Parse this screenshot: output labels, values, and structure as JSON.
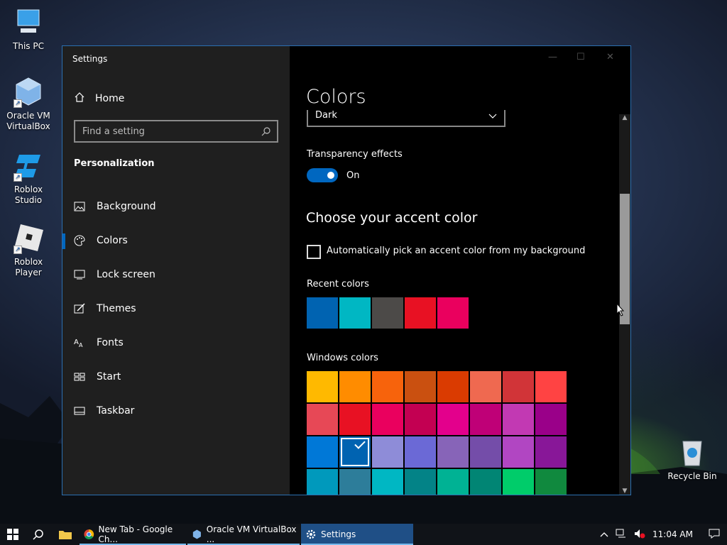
{
  "desktop": {
    "icons": [
      {
        "label": "This PC"
      },
      {
        "label": "Oracle VM VirtualBox"
      },
      {
        "label": "Roblox Studio"
      },
      {
        "label": "Roblox Player"
      },
      {
        "label": "Recycle Bin"
      }
    ]
  },
  "window": {
    "title": "Settings",
    "sidebar": {
      "home_label": "Home",
      "search_placeholder": "Find a setting",
      "section_title": "Personalization",
      "items": [
        {
          "label": "Background",
          "icon": "picture-icon"
        },
        {
          "label": "Colors",
          "icon": "palette-icon",
          "selected": true
        },
        {
          "label": "Lock screen",
          "icon": "lock-screen-icon"
        },
        {
          "label": "Themes",
          "icon": "brush-icon"
        },
        {
          "label": "Fonts",
          "icon": "fonts-icon"
        },
        {
          "label": "Start",
          "icon": "start-icon"
        },
        {
          "label": "Taskbar",
          "icon": "taskbar-icon"
        }
      ]
    },
    "content": {
      "page_title": "Colors",
      "mode_dropdown_value": "Dark",
      "transparency_label": "Transparency effects",
      "transparency_state": "On",
      "accent_heading": "Choose your accent color",
      "auto_accent_label": "Automatically pick an accent color from my background",
      "auto_accent_checked": false,
      "recent_colors_label": "Recent colors",
      "recent_colors": [
        "#0063b1",
        "#00b7c3",
        "#4c4a48",
        "#e81123",
        "#ea005e"
      ],
      "windows_colors_label": "Windows colors",
      "windows_colors": [
        [
          "#ffb900",
          "#ff8c00",
          "#f7630c",
          "#ca5010",
          "#da3b01",
          "#ef6950",
          "#d13438",
          "#ff4343"
        ],
        [
          "#e74856",
          "#e81123",
          "#ea005e",
          "#c30052",
          "#e3008c",
          "#bf0077",
          "#c239b3",
          "#9a0089"
        ],
        [
          "#0078d7",
          "#0063b1",
          "#8e8cd8",
          "#6b69d6",
          "#8764b8",
          "#744da9",
          "#b146c2",
          "#881798"
        ],
        [
          "#0099bc",
          "#2d7d9a",
          "#00b7c3",
          "#038387",
          "#00b294",
          "#018574",
          "#00cc6a",
          "#10893e"
        ]
      ],
      "selected_color": "#0063b1",
      "scroll_position": 0.3
    }
  },
  "taskbar": {
    "tasks": [
      {
        "label": "New Tab - Google Ch...",
        "icon": "chrome-icon"
      },
      {
        "label": "Oracle VM VirtualBox ...",
        "icon": "virtualbox-icon"
      },
      {
        "label": "Settings",
        "icon": "settings-gear-icon",
        "active": true
      }
    ],
    "clock": "11:04 AM"
  }
}
